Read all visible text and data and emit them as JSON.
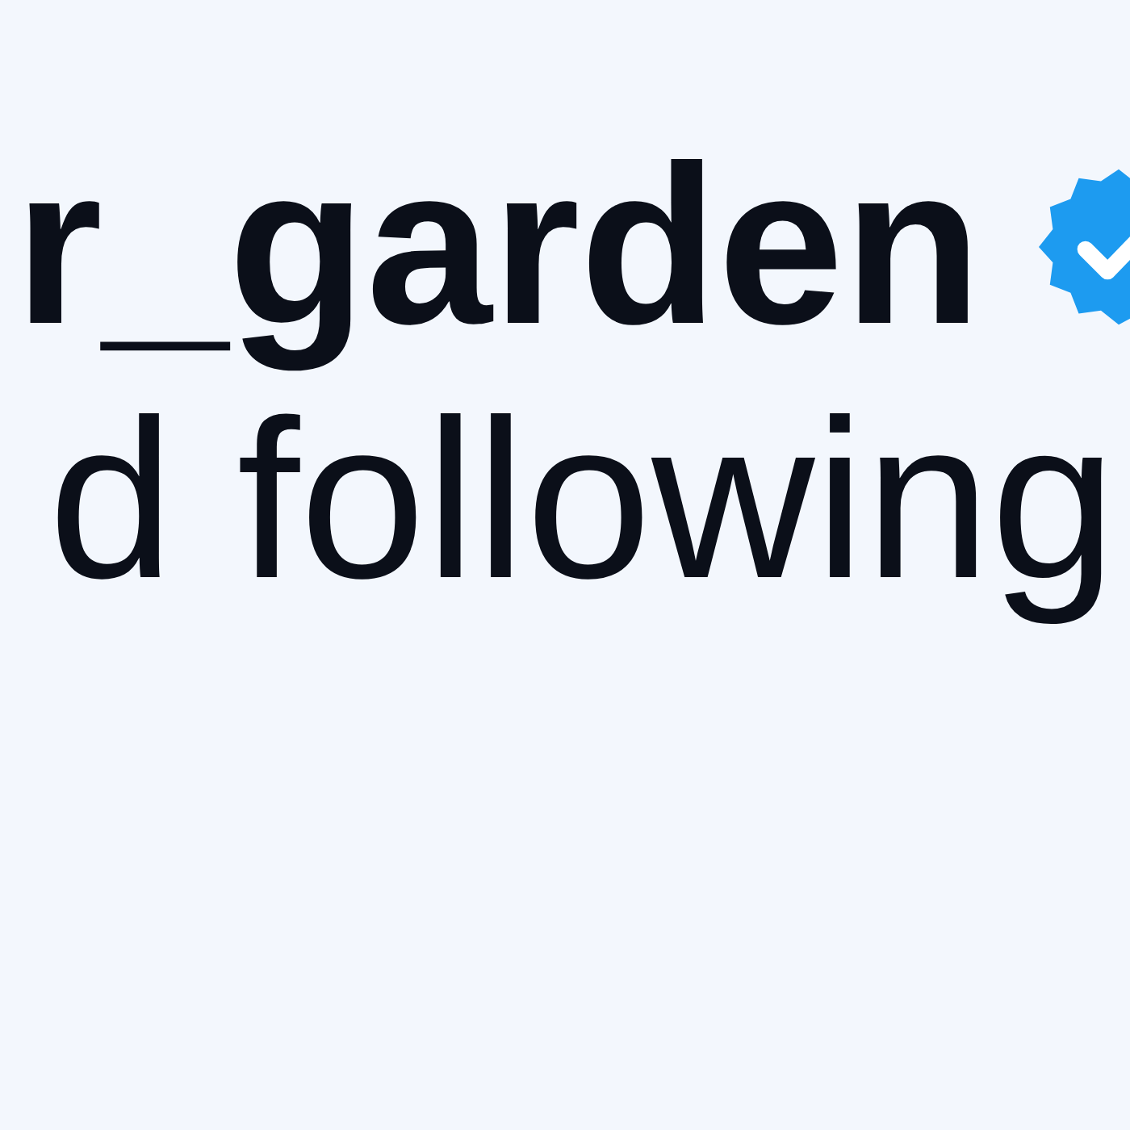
{
  "user": {
    "username": "r_garden",
    "verified": true
  },
  "status": "d following"
}
